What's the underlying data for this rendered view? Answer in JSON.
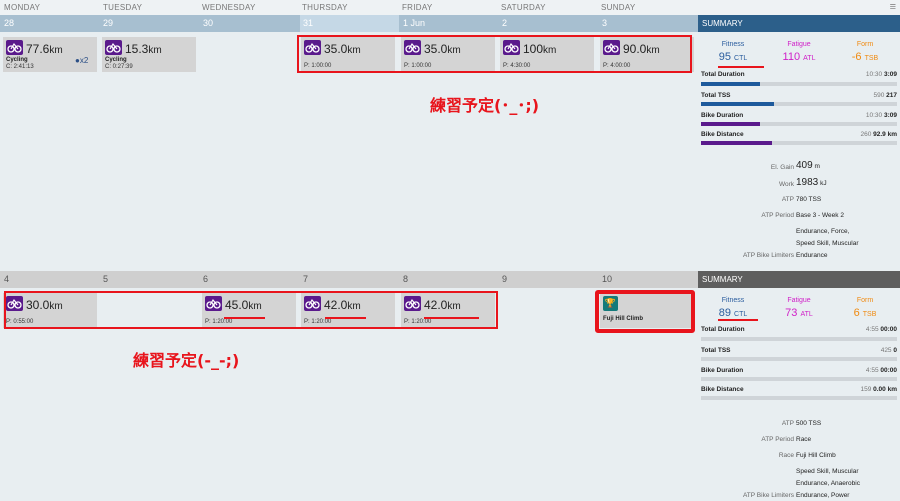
{
  "weekdays": [
    "MONDAY",
    "TUESDAY",
    "WEDNESDAY",
    "THURSDAY",
    "FRIDAY",
    "SATURDAY",
    "SUNDAY"
  ],
  "week1": {
    "dates": [
      "28",
      "29",
      "30",
      "31",
      "1 Jun",
      "2",
      "3"
    ],
    "summary_title": "SUMMARY",
    "cards": [
      {
        "km_num": "77.6",
        "km_unit": "km",
        "label": "Cycling",
        "line": "C: 2:41:13",
        "extra": "x2"
      },
      {
        "km_num": "15.3",
        "km_unit": "km",
        "label": "Cycling",
        "line": "C: 0:27:39"
      },
      {
        "km_num": "35.0",
        "km_unit": "km",
        "line": "P: 1:00:00"
      },
      {
        "km_num": "35.0",
        "km_unit": "km",
        "line": "P: 1:00:00"
      },
      {
        "km_num": "100",
        "km_unit": "km",
        "line": "P: 4:30:00"
      },
      {
        "km_num": "90.0",
        "km_unit": "km",
        "line": "P: 4:00:00"
      }
    ],
    "annotation": "練習予定(･_･;)",
    "fitness": {
      "label": "Fitness",
      "value": "95",
      "unit": "CTL"
    },
    "fatigue": {
      "label": "Fatigue",
      "value": "110",
      "unit": "ATL"
    },
    "form": {
      "label": "Form",
      "value": "-6",
      "unit": "TSB"
    },
    "rows": [
      {
        "name": "Total Duration",
        "planned": "10:30",
        "actual": "3:09"
      },
      {
        "name": "Total TSS",
        "planned": "590",
        "actual": "217"
      },
      {
        "name": "Bike Duration",
        "planned": "10:30",
        "actual": "3:09"
      },
      {
        "name": "Bike Distance",
        "planned": "260",
        "actual": "92.9 km"
      }
    ],
    "progress": [
      0.3,
      0.37,
      0.3,
      0.36
    ],
    "details": [
      {
        "k": "El. Gain",
        "v": "409",
        "u": "m"
      },
      {
        "k": "Work",
        "v": "1983",
        "u": "kJ"
      },
      {
        "k": "ATP",
        "v": "780 TSS"
      },
      {
        "k": "ATP Period",
        "v": "Base 3 - Week 2"
      },
      {
        "k": "ATP Bike Limiters",
        "v1": "Endurance, Force,",
        "v2": "Speed Skill, Muscular",
        "v3": "Endurance"
      }
    ]
  },
  "week2": {
    "dates": [
      "4",
      "5",
      "6",
      "7",
      "8",
      "9",
      "10"
    ],
    "summary_title": "SUMMARY",
    "cards": [
      {
        "km_num": "30.0",
        "km_unit": "km",
        "line": "P: 0:55:00"
      },
      {
        "km_num": "45.0",
        "km_unit": "km",
        "line": "P: 1:20:00"
      },
      {
        "km_num": "42.0",
        "km_unit": "km",
        "line": "P: 1:20:00"
      },
      {
        "km_num": "42.0",
        "km_unit": "km",
        "line": "P: 1:20:00"
      }
    ],
    "event": {
      "label": "Fuji Hill Climb"
    },
    "annotation": "練習予定(-_-;)",
    "fitness": {
      "label": "Fitness",
      "value": "89",
      "unit": "CTL"
    },
    "fatigue": {
      "label": "Fatigue",
      "value": "73",
      "unit": "ATL"
    },
    "form": {
      "label": "Form",
      "value": "6",
      "unit": "TSB"
    },
    "rows": [
      {
        "name": "Total Duration",
        "planned": "4:55",
        "actual": "00:00"
      },
      {
        "name": "Total TSS",
        "planned": "425",
        "actual": "0"
      },
      {
        "name": "Bike Duration",
        "planned": "4:55",
        "actual": "00:00"
      },
      {
        "name": "Bike Distance",
        "planned": "159",
        "actual": "0.00 km"
      }
    ],
    "details": [
      {
        "k": "ATP",
        "v": "500 TSS"
      },
      {
        "k": "ATP Period",
        "v": "Race"
      },
      {
        "k": "Race",
        "v": "Fuji Hill Climb"
      },
      {
        "k": "ATP Bike Limiters",
        "v1": "Speed Skill, Muscular",
        "v2": "Endurance, Anaerobic",
        "v3": "Endurance, Power"
      }
    ]
  },
  "colors": {
    "accent_red": "#e8141c",
    "bike_purple": "#5a1a8c",
    "summary_blue": "#2c5f8a",
    "fitness_blue": "#2b5d9e",
    "fatigue_pink": "#d020c8",
    "form_orange": "#f08a10"
  }
}
